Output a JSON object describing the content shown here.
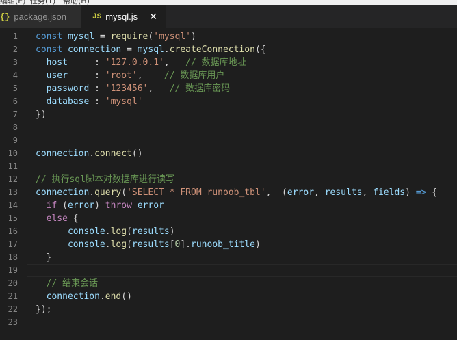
{
  "menubar": {
    "items": [
      "编辑(E)",
      "任务(T)",
      "帮助(H)"
    ]
  },
  "tabs": [
    {
      "label": "package.json",
      "icon": "{}",
      "active": false
    },
    {
      "label": "mysql.js",
      "icon": "JS",
      "active": true,
      "close": "✕"
    }
  ],
  "editor": {
    "line_numbers": [
      "1",
      "2",
      "3",
      "4",
      "5",
      "6",
      "7",
      "8",
      "9",
      "10",
      "11",
      "12",
      "13",
      "14",
      "15",
      "16",
      "17",
      "18",
      "19",
      "20",
      "21",
      "22",
      "23"
    ],
    "lines": [
      [
        [
          "kw",
          "const "
        ],
        [
          "var",
          "mysql"
        ],
        [
          "pun",
          " = "
        ],
        [
          "fn",
          "require"
        ],
        [
          "pun",
          "("
        ],
        [
          "str",
          "'mysql'"
        ],
        [
          "pun",
          ")"
        ]
      ],
      [
        [
          "kw",
          "const "
        ],
        [
          "var",
          "connection"
        ],
        [
          "pun",
          " = "
        ],
        [
          "var",
          "mysql"
        ],
        [
          "pun",
          "."
        ],
        [
          "fn",
          "createConnection"
        ],
        [
          "pun",
          "({"
        ]
      ],
      [
        [
          "pun",
          "  "
        ],
        [
          "var",
          "host"
        ],
        [
          "pun",
          "     : "
        ],
        [
          "str",
          "'127.0.0.1'"
        ],
        [
          "pun",
          ",   "
        ],
        [
          "cmt",
          "// 数据库地址"
        ]
      ],
      [
        [
          "pun",
          "  "
        ],
        [
          "var",
          "user"
        ],
        [
          "pun",
          "     : "
        ],
        [
          "str",
          "'root'"
        ],
        [
          "pun",
          ",    "
        ],
        [
          "cmt",
          "// 数据库用户"
        ]
      ],
      [
        [
          "pun",
          "  "
        ],
        [
          "var",
          "password"
        ],
        [
          "pun",
          " : "
        ],
        [
          "str",
          "'123456'"
        ],
        [
          "pun",
          ",   "
        ],
        [
          "cmt",
          "// 数据库密码"
        ]
      ],
      [
        [
          "pun",
          "  "
        ],
        [
          "var",
          "database"
        ],
        [
          "pun",
          " : "
        ],
        [
          "str",
          "'mysql'"
        ]
      ],
      [
        [
          "pun",
          "})"
        ]
      ],
      [],
      [],
      [
        [
          "var",
          "connection"
        ],
        [
          "pun",
          "."
        ],
        [
          "fn",
          "connect"
        ],
        [
          "pun",
          "()"
        ]
      ],
      [],
      [
        [
          "cmt",
          "// 执行sql脚本对数据库进行读写"
        ]
      ],
      [
        [
          "var",
          "connection"
        ],
        [
          "pun",
          "."
        ],
        [
          "fn",
          "query"
        ],
        [
          "pun",
          "("
        ],
        [
          "str",
          "'SELECT * FROM runoob_tbl'"
        ],
        [
          "pun",
          ",  ("
        ],
        [
          "var",
          "error"
        ],
        [
          "pun",
          ", "
        ],
        [
          "var",
          "results"
        ],
        [
          "pun",
          ", "
        ],
        [
          "var",
          "fields"
        ],
        [
          "pun",
          ") "
        ],
        [
          "kw",
          "=>"
        ],
        [
          "pun",
          " {"
        ]
      ],
      [
        [
          "pun",
          "  "
        ],
        [
          "ctrl",
          "if"
        ],
        [
          "pun",
          " ("
        ],
        [
          "var",
          "error"
        ],
        [
          "pun",
          ") "
        ],
        [
          "ctrl",
          "throw"
        ],
        [
          "pun",
          " "
        ],
        [
          "var",
          "error"
        ]
      ],
      [
        [
          "pun",
          "  "
        ],
        [
          "ctrl",
          "else"
        ],
        [
          "pun",
          " {"
        ]
      ],
      [
        [
          "pun",
          "      "
        ],
        [
          "var",
          "console"
        ],
        [
          "pun",
          "."
        ],
        [
          "fn",
          "log"
        ],
        [
          "pun",
          "("
        ],
        [
          "var",
          "results"
        ],
        [
          "pun",
          ")"
        ]
      ],
      [
        [
          "pun",
          "      "
        ],
        [
          "var",
          "console"
        ],
        [
          "pun",
          "."
        ],
        [
          "fn",
          "log"
        ],
        [
          "pun",
          "("
        ],
        [
          "var",
          "results"
        ],
        [
          "pun",
          "["
        ],
        [
          "num",
          "0"
        ],
        [
          "pun",
          "]."
        ],
        [
          "var",
          "runoob_title"
        ],
        [
          "pun",
          ")"
        ]
      ],
      [
        [
          "pun",
          "  }"
        ]
      ],
      [],
      [
        [
          "pun",
          "  "
        ],
        [
          "cmt",
          "// 结束会话"
        ]
      ],
      [
        [
          "pun",
          "  "
        ],
        [
          "var",
          "connection"
        ],
        [
          "pun",
          "."
        ],
        [
          "fn",
          "end"
        ],
        [
          "pun",
          "()"
        ]
      ],
      [
        [
          "pun",
          "});"
        ]
      ],
      []
    ]
  }
}
